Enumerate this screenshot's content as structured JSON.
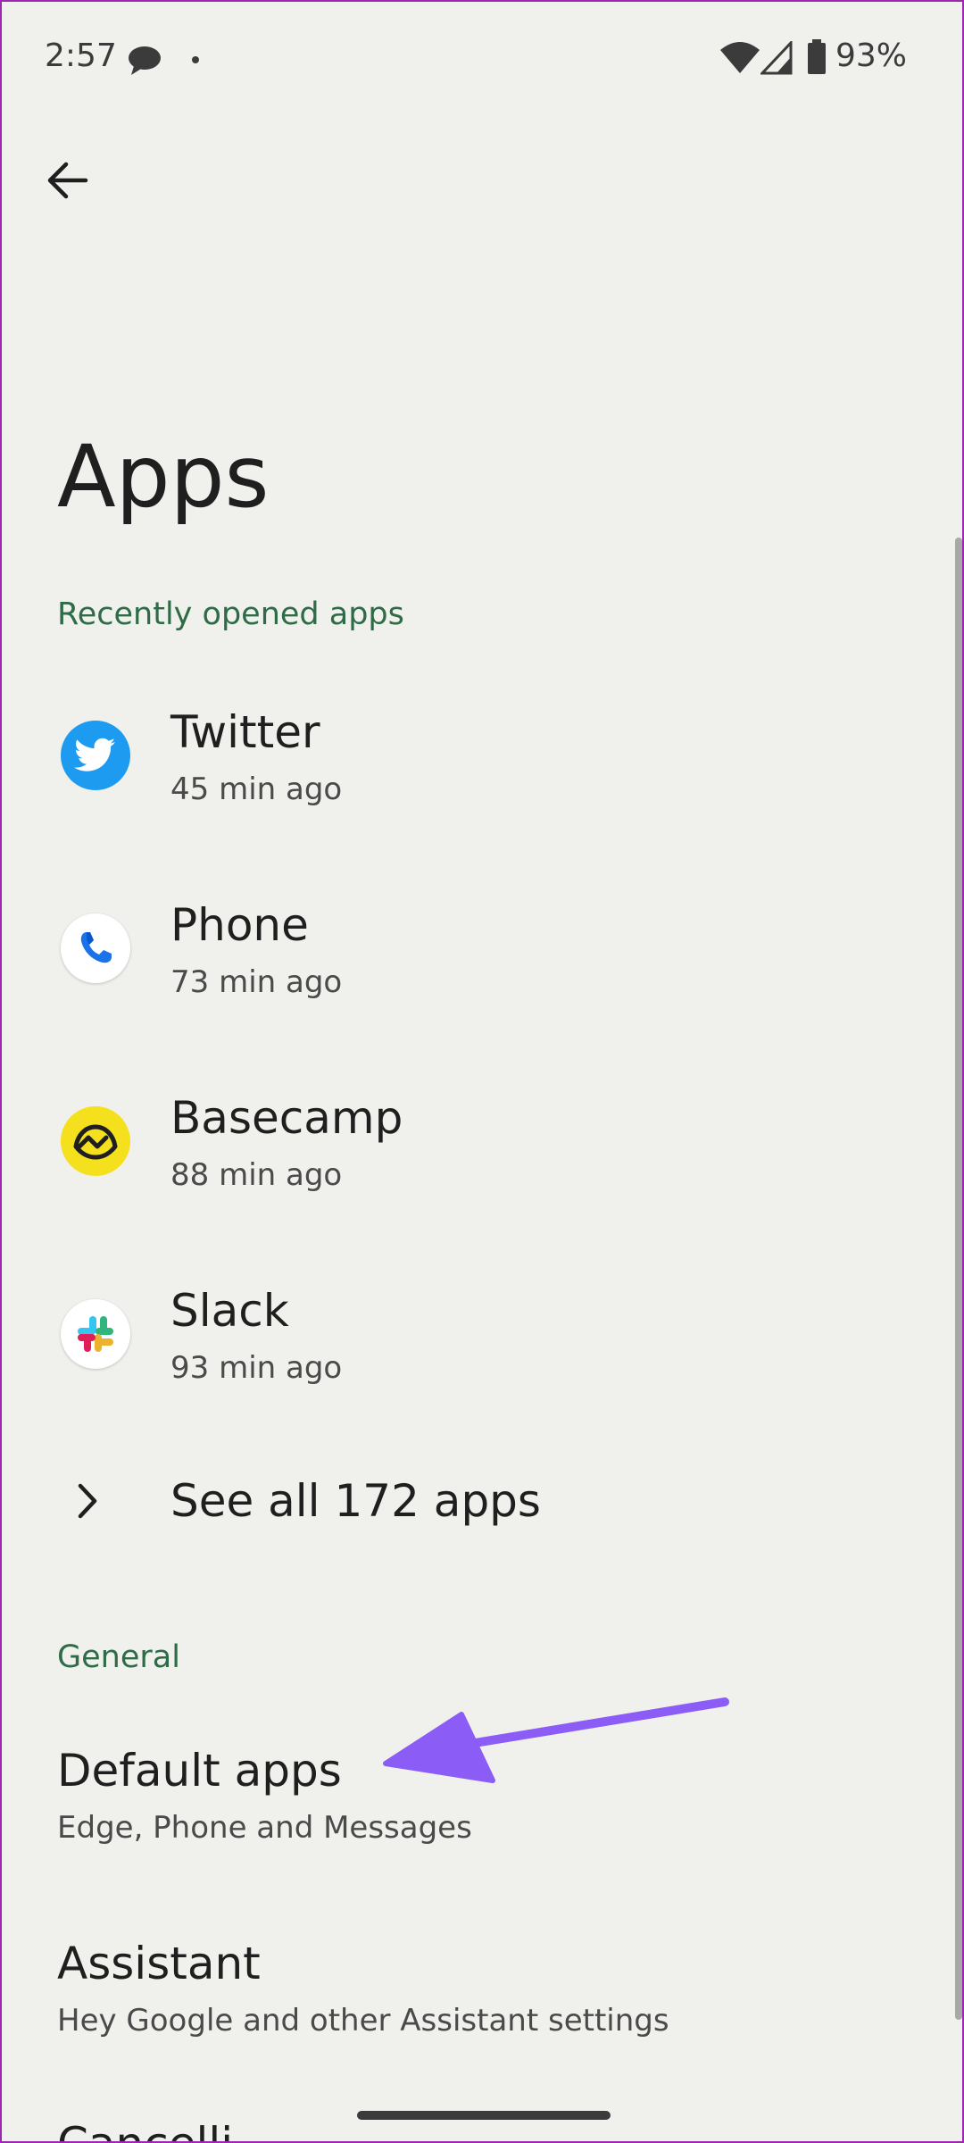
{
  "status_bar": {
    "time": "2:57",
    "battery": "93%"
  },
  "page": {
    "title": "Apps"
  },
  "recent": {
    "header": "Recently opened apps",
    "apps": [
      {
        "name": "Twitter",
        "time": "45 min ago",
        "icon": "twitter-icon",
        "color": "#1d9bf0"
      },
      {
        "name": "Phone",
        "time": "73 min ago",
        "icon": "phone-icon",
        "color": "#ffffff"
      },
      {
        "name": "Basecamp",
        "time": "88 min ago",
        "icon": "basecamp-icon",
        "color": "#f4e01c"
      },
      {
        "name": "Slack",
        "time": "93 min ago",
        "icon": "slack-icon",
        "color": "#ffffff"
      }
    ],
    "see_all": "See all 172 apps"
  },
  "general": {
    "header": "General",
    "items": [
      {
        "title": "Default apps",
        "subtitle": "Edge, Phone and Messages"
      },
      {
        "title": "Assistant",
        "subtitle": "Hey Google and other Assistant settings"
      }
    ],
    "partial_item": "Cancelli"
  },
  "colors": {
    "accent": "#2e6b46",
    "annotation_arrow": "#8b5cf6",
    "background": "#f0f0ec"
  }
}
